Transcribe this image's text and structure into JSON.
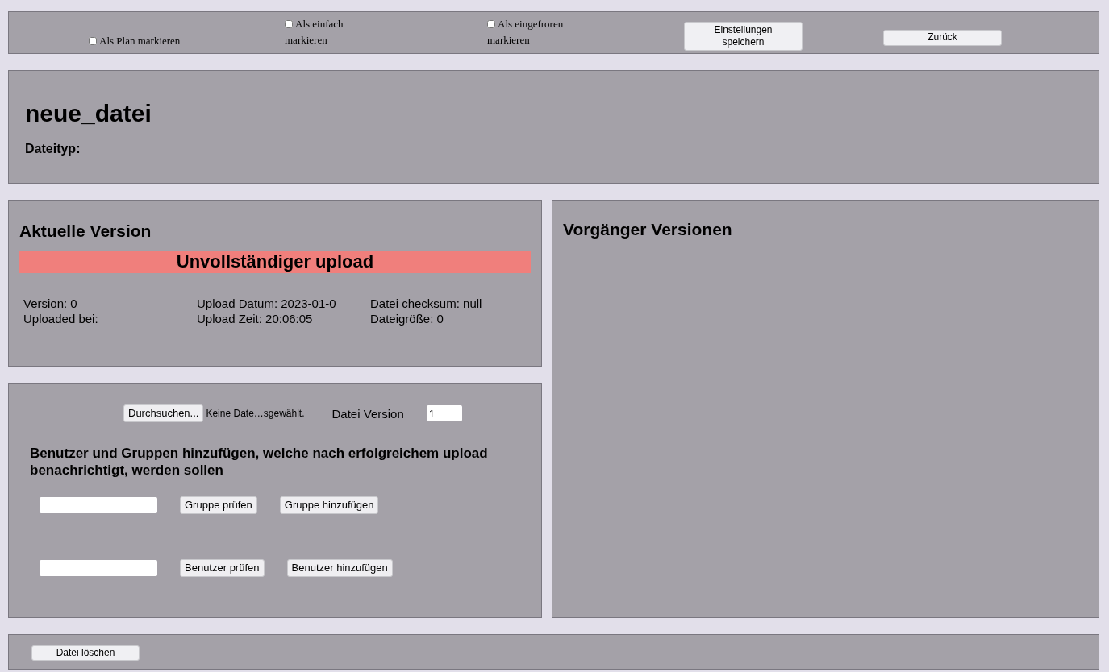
{
  "toolbar": {
    "checkboxes": [
      {
        "label": "Als Plan markieren",
        "checked": false
      },
      {
        "label": "Als einfach markieren",
        "checked": false
      },
      {
        "label": "Als eingefroren markieren",
        "checked": false
      }
    ],
    "buttons": [
      "Einstellungen speichern",
      "Zurück"
    ]
  },
  "file": {
    "name": "neue_datei",
    "type_label": "Dateityp:"
  },
  "current_version": {
    "title": "Aktuelle Version",
    "status": "Unvollständiger upload",
    "fields": [
      {
        "text": "Version: 0"
      },
      {
        "text": "Upload Datum: 2023-01-0"
      },
      {
        "text": "Datei checksum: null"
      },
      {
        "text": "Uploaded bei:"
      },
      {
        "text": "Upload Zeit: 20:06:05"
      },
      {
        "text": "Dateigröße: 0"
      }
    ]
  },
  "upload": {
    "browse_button": "Durchsuchen...",
    "file_status": "Keine Date…sgewählt.",
    "version_label": "Datei Version",
    "version_value": "1",
    "notify_heading": "Benutzer und Gruppen hinzufügen, welche nach erfolgreichem upload benachrichtigt, werden sollen",
    "rows": [
      {
        "buttons": [
          "Gruppe prüfen",
          "Gruppe hinzufügen"
        ]
      },
      {
        "buttons": [
          "Benutzer prüfen",
          "Benutzer hinzufügen"
        ]
      }
    ]
  },
  "previous_versions": {
    "title": "Vorgänger Versionen"
  },
  "footer": {
    "delete_button": "Datei löschen"
  }
}
